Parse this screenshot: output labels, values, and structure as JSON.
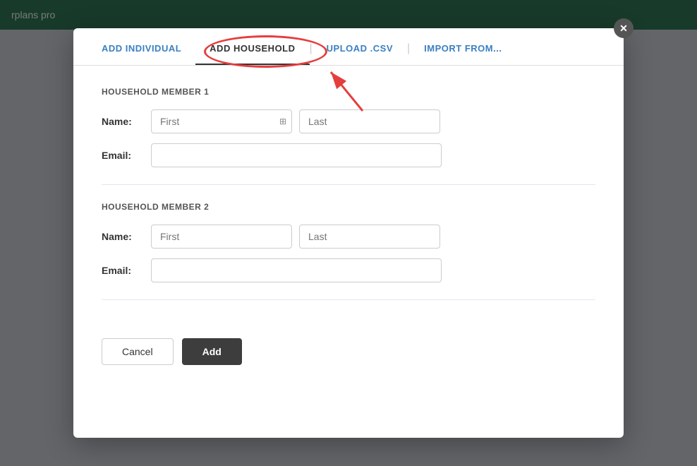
{
  "topbar": {
    "logo_text": "rplans pro"
  },
  "modal": {
    "close_label": "✕",
    "tabs": [
      {
        "id": "add-individual",
        "label": "ADD INDIVIDUAL",
        "active": false
      },
      {
        "id": "add-household",
        "label": "ADD HOUSEHOLD",
        "active": true
      },
      {
        "id": "upload-csv",
        "label": "UPLOAD .CSV",
        "active": false
      },
      {
        "id": "import-from",
        "label": "IMPORT FROM...",
        "active": false
      }
    ],
    "member1": {
      "heading": "HOUSEHOLD MEMBER 1",
      "name_label": "Name:",
      "first_placeholder": "First",
      "last_placeholder": "Last",
      "email_label": "Email:",
      "email_placeholder": ""
    },
    "member2": {
      "heading": "HOUSEHOLD MEMBER 2",
      "name_label": "Name:",
      "first_placeholder": "First",
      "last_placeholder": "Last",
      "email_label": "Email:",
      "email_placeholder": ""
    },
    "footer": {
      "cancel_label": "Cancel",
      "add_label": "Add"
    }
  }
}
